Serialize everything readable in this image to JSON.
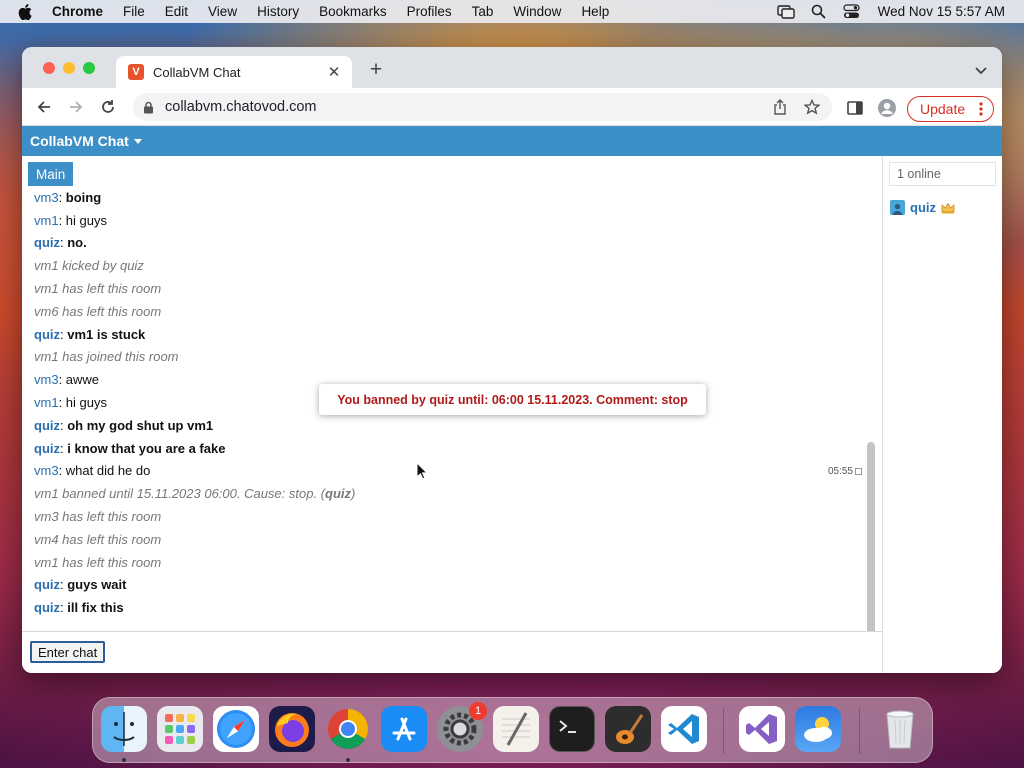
{
  "menubar": {
    "app_name": "Chrome",
    "items": [
      "File",
      "Edit",
      "View",
      "History",
      "Bookmarks",
      "Profiles",
      "Tab",
      "Window",
      "Help"
    ],
    "clock": "Wed Nov 15  5:57 AM"
  },
  "browser": {
    "tab_title": "CollabVM Chat",
    "url": "collabvm.chatovod.com",
    "update_label": "Update"
  },
  "chat": {
    "header_title": "CollabVM Chat",
    "room_tab": "Main",
    "messages": [
      {
        "nick": "vm3",
        "sep": ": ",
        "text": "boing"
      },
      {
        "nick": "vm1",
        "sep": ": ",
        "text": "hi guys"
      },
      {
        "nick": "quiz",
        "sep": ": ",
        "text": "no."
      },
      {
        "system": "vm1 kicked by quiz"
      },
      {
        "system": "vm1 has left this room"
      },
      {
        "system": "vm6 has left this room"
      },
      {
        "nick": "quiz",
        "sep": ": ",
        "text": "vm1 is stuck"
      },
      {
        "system": "vm1 has joined this room"
      },
      {
        "nick": "vm3",
        "sep": ": ",
        "text": "awwe"
      },
      {
        "nick": "vm1",
        "sep": ": ",
        "text": "hi guys"
      },
      {
        "nick": "quiz",
        "sep": ": ",
        "text": "oh my god shut up vm1"
      },
      {
        "nick": "quiz",
        "sep": ": ",
        "text": "i know that you are a fake"
      },
      {
        "nick": "vm3",
        "sep": ": ",
        "text": "what did he do",
        "time": "05:55"
      },
      {
        "system": "vm1 banned until 15.11.2023 06:00. Cause: stop. (",
        "who": "quiz",
        "end": ")"
      },
      {
        "system": "vm3 has left this room"
      },
      {
        "system": "vm4 has left this room"
      },
      {
        "system": "vm1 has left this room"
      },
      {
        "nick": "quiz",
        "sep": ": ",
        "text": "guys wait"
      },
      {
        "nick": "quiz",
        "sep": ": ",
        "text": "ill fix this"
      }
    ],
    "enter_chat_label": "Enter chat",
    "online_count": "1 online",
    "users": [
      {
        "name": "quiz"
      }
    ],
    "toast": "You banned by quiz until: 06:00 15.11.2023. Comment: stop"
  },
  "dock": {
    "apps": [
      "Finder",
      "Launchpad",
      "Safari",
      "Firefox",
      "Chrome",
      "App Store",
      "System Settings",
      "TextEdit",
      "Terminal",
      "GarageBand",
      "Visual Studio Code",
      "Visual Studio",
      "Weather",
      "Trash"
    ],
    "system_settings_badge": "1"
  },
  "colors": {
    "header_blue": "#3d8fc8",
    "nick_blue": "#2a6fb0",
    "ban_red": "#b01a1a",
    "update_red": "#d93025"
  }
}
